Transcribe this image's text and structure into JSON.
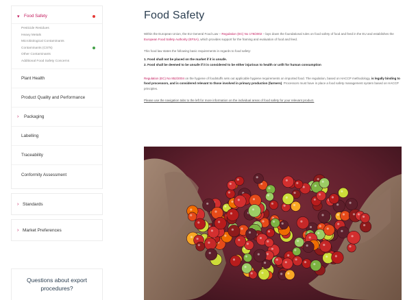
{
  "sidebar": {
    "active": {
      "label": "Food Safety"
    },
    "subitems": [
      {
        "label": "Pesticide Residues",
        "dot": false
      },
      {
        "label": "Heavy Metals",
        "dot": false
      },
      {
        "label": "Microbiological Contaminants",
        "dot": false
      },
      {
        "label": "Contaminants (CSTs)",
        "dot": true
      },
      {
        "label": "Other Contaminants",
        "dot": false
      },
      {
        "label": "Additional Food Safety Concerns",
        "dot": false
      }
    ],
    "items": [
      {
        "label": "Plant Health",
        "chevron": false
      },
      {
        "label": "Product Quality and Performance",
        "chevron": false
      },
      {
        "label": "Packaging",
        "chevron": true
      },
      {
        "label": "Labelling",
        "chevron": false
      },
      {
        "label": "Traceability",
        "chevron": false
      },
      {
        "label": "Conformity Assessment",
        "chevron": false
      }
    ],
    "standards": "Standards",
    "market_preferences": "Market Preferences",
    "cta_line1": "Questions about export",
    "cta_line2": "procedures?"
  },
  "colors": {
    "accent": "#c2185b",
    "dot_red": "#e53935",
    "dot_green": "#43a047",
    "title": "#2b3e50"
  },
  "main": {
    "title": "Food Safety",
    "p1_a": "Within the European Union, the EU General Food Law – ",
    "p1_link": "Regulation (EC) No 178/2002",
    "p1_b": " – lays down the foundational rules on food safety of food and feed in the EU and establishes the ",
    "p1_link2": "European Food Safety Authority (EFSA)",
    "p1_c": ", which provides support for the framing and evaluation of food and feed.",
    "p2": "This food law states the following basic requirements in regards to food safety:",
    "list1": "1.  Food shall not be placed on the market if it is unsafe.",
    "list2": "2.  Food shall be deemed to be unsafe if it is considered to be either injurious to health or unfit for human consumption",
    "p3_link": "Regulation (EC) No 852/2004",
    "p3_a": " on the hygiene of foodstuffs sets out applicable hygiene requirements on imported food. The regulation, based on HACCP methodology, ",
    "p3_b": "is legally binding to food processors, and is considered relevant to those involved in primary production (farmers)",
    "p3_c": ". Processors must have in place a food safety management system based on HACCP principles.",
    "p4": "Please use the navigation tabs to the left for more information on the individual areas of food safety for your relevant product."
  },
  "image": {
    "alt": "coffee-cherries-in-hands"
  }
}
